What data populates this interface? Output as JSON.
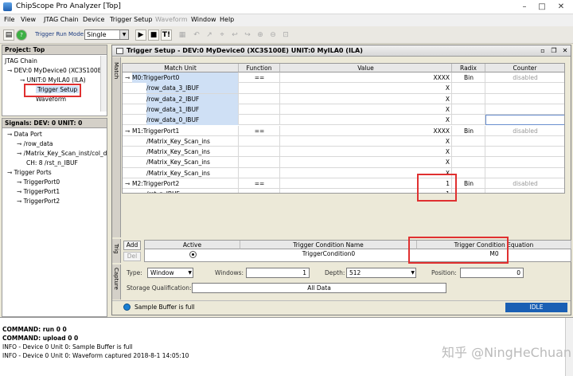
{
  "window": {
    "title": "ChipScope Pro Analyzer [Top]"
  },
  "menu": [
    "File",
    "View",
    "JTAG Chain",
    "Device",
    "Trigger Setup",
    "Waveform",
    "Window",
    "Help"
  ],
  "toolbar": {
    "run_mode_label": "Trigger Run Mode:",
    "run_mode_value": "Single",
    "trigger_now": "T!"
  },
  "project": {
    "header": "Project: Top",
    "items": [
      "JTAG Chain",
      "DEV:0 MyDevice0 (XC3S100E)",
      "UNIT:0 MyILA0 (ILA)",
      "Trigger Setup",
      "Waveform"
    ]
  },
  "signals": {
    "header": "Signals: DEV: 0 UNIT: 0",
    "items": [
      "Data Port",
      "/row_data",
      "/Matrix_Key_Scan_inst/col_d",
      "CH: 8 /rst_n_IBUF",
      "Trigger Ports",
      "TriggerPort0",
      "TriggerPort1",
      "TriggerPort2"
    ]
  },
  "trigger_setup": {
    "title": "Trigger Setup - DEV:0 MyDevice0 (XC3S100E) UNIT:0 MyILA0 (ILA)",
    "side_tabs": [
      "Match",
      "Trig",
      "Capture"
    ],
    "columns": [
      "Match Unit",
      "Function",
      "Value",
      "Radix",
      "Counter"
    ],
    "rows": [
      {
        "unit": "M0:TriggerPort0",
        "function": "==",
        "value": "XXXX",
        "radix": "Bin",
        "counter": "disabled",
        "kind": "group"
      },
      {
        "unit": "/row_data_3_IBUF",
        "function": "",
        "value": "X",
        "radix": "",
        "counter": "",
        "kind": "child"
      },
      {
        "unit": "/row_data_2_IBUF",
        "function": "",
        "value": "X",
        "radix": "",
        "counter": "",
        "kind": "child"
      },
      {
        "unit": "/row_data_1_IBUF",
        "function": "",
        "value": "X",
        "radix": "",
        "counter": "",
        "kind": "child"
      },
      {
        "unit": "/row_data_0_IBUF",
        "function": "",
        "value": "X",
        "radix": "",
        "counter": "",
        "kind": "child"
      },
      {
        "unit": "M1:TriggerPort1",
        "function": "==",
        "value": "XXXX",
        "radix": "Bin",
        "counter": "disabled",
        "kind": "group"
      },
      {
        "unit": "/Matrix_Key_Scan_ins",
        "function": "",
        "value": "X",
        "radix": "",
        "counter": "",
        "kind": "child2"
      },
      {
        "unit": "/Matrix_Key_Scan_ins",
        "function": "",
        "value": "X",
        "radix": "",
        "counter": "",
        "kind": "child2"
      },
      {
        "unit": "/Matrix_Key_Scan_ins",
        "function": "",
        "value": "X",
        "radix": "",
        "counter": "",
        "kind": "child2"
      },
      {
        "unit": "/Matrix_Key_Scan_ins",
        "function": "",
        "value": "X",
        "radix": "",
        "counter": "",
        "kind": "child2"
      },
      {
        "unit": "M2:TriggerPort2",
        "function": "==",
        "value": "1",
        "radix": "Bin",
        "counter": "disabled",
        "kind": "group"
      },
      {
        "unit": "/rst_n_IBUF",
        "function": "",
        "value": "1",
        "radix": "",
        "counter": "",
        "kind": "child2"
      }
    ],
    "condition": {
      "add": "Add",
      "del": "Del",
      "headers": [
        "Active",
        "Trigger Condition Name",
        "Trigger Condition Equation"
      ],
      "name": "TriggerCondition0",
      "equation": "M0"
    },
    "capture": {
      "type_label": "Type:",
      "type_value": "Window",
      "windows_label": "Windows:",
      "windows_value": "1",
      "depth_label": "Depth:",
      "depth_value": "512",
      "position_label": "Position:",
      "position_value": "0",
      "storage_label": "Storage Qualification:",
      "storage_value": "All Data"
    },
    "status": {
      "text": "Sample Buffer is full",
      "state": "IDLE"
    }
  },
  "console": {
    "lines": [
      "COMMAND: run 0 0",
      "COMMAND: upload 0 0",
      "INFO - Device 0 Unit 0:  Sample Buffer is full",
      "INFO - Device 0 Unit 0: Waveform captured 2018-8-1 14:05:10"
    ]
  },
  "watermark": "知乎 @NingHeChuan",
  "colors": {
    "selection": "#cfe0f5",
    "highlight_box": "#e03030",
    "idle": "#1a5fb4"
  }
}
